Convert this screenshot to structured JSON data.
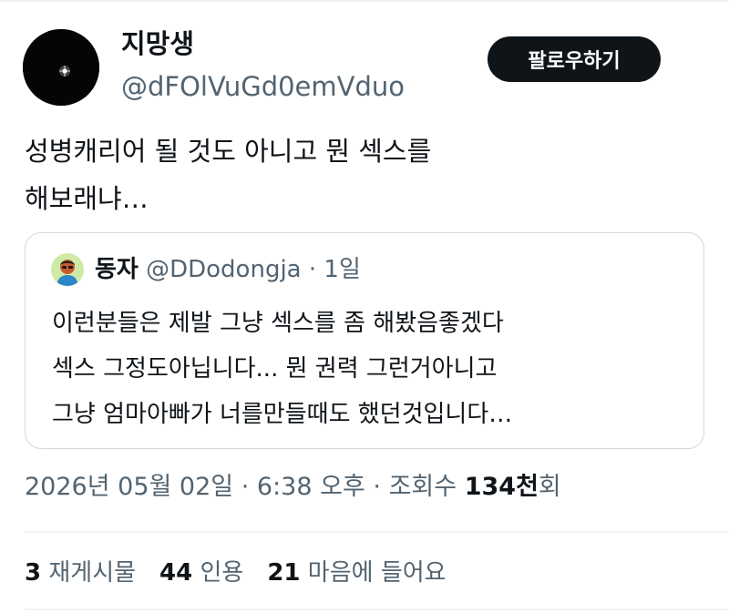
{
  "author": {
    "name": "지망생",
    "handle": "@dFOlVuGd0emVduo",
    "avatar_icon": "starry-night-avatar-icon"
  },
  "follow_label": "팔로우하기",
  "tweet": {
    "lines": [
      "성병캐리어 될 것도 아니고 뭔 섹스를",
      "해보래냐…"
    ]
  },
  "quote": {
    "avatar_icon": "person-avatar-icon",
    "name": "동자",
    "handle": "@DDodongja",
    "separator": "·",
    "time": "1일",
    "lines": [
      "이런분들은 제발 그냥 섹스를 좀 해봤음좋겠다",
      "섹스 그정도아닙니다... 뭔 권력 그런거아니고",
      "그냥 엄마아빠가 너를만들때도 했던것입니다…"
    ]
  },
  "meta": {
    "date": "2026년 05월 02일",
    "separator": "·",
    "time": "6:38 오후",
    "views_label": "조회수",
    "views_number": "134천",
    "views_suffix": "회"
  },
  "stats": [
    {
      "count": "3",
      "label": "재게시물"
    },
    {
      "count": "44",
      "label": "인용"
    },
    {
      "count": "21",
      "label": "마음에 들어요"
    }
  ]
}
